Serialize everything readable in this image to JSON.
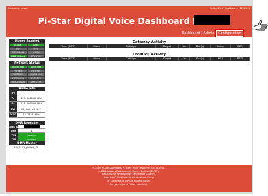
{
  "top_strip": {
    "left": "Hostname: pi-star",
    "right": "Pi-Star:4.1.4 / Dashboard: 20220311"
  },
  "header": {
    "title": "Pi-Star Digital Voice Dashboard for"
  },
  "nav": {
    "dashboard": "Dashboard",
    "separator": "|",
    "admin": "Admin",
    "configuration": "Configuration"
  },
  "modes": {
    "title": "Modes Enabled",
    "items": [
      {
        "label": "D-Star",
        "state": "on"
      },
      {
        "label": "DMR",
        "state": "on"
      },
      {
        "label": "YSF",
        "state": "off"
      },
      {
        "label": "P25",
        "state": "off"
      },
      {
        "label": "YSF XMode",
        "state": "off"
      },
      {
        "label": "NXDN",
        "state": "off"
      },
      {
        "label": "DMR XMode",
        "state": "on"
      },
      {
        "label": "POCSAG",
        "state": "off"
      }
    ]
  },
  "network": {
    "title": "Network Status",
    "items": [
      {
        "label": "D-Star Net",
        "state": "on"
      },
      {
        "label": "DMR Net",
        "state": "on"
      },
      {
        "label": "YSF Net",
        "state": "off"
      },
      {
        "label": "P25 Net",
        "state": "off"
      },
      {
        "label": "YSF2DMR",
        "state": "off"
      },
      {
        "label": "NXDN Net",
        "state": "off"
      },
      {
        "label": "YSF2NXDN",
        "state": "off"
      },
      {
        "label": "YSF2P25",
        "state": "off"
      },
      {
        "label": "DMR2NXDN",
        "state": "off"
      },
      {
        "label": "DMR2YSF",
        "state": "off"
      }
    ]
  },
  "radio": {
    "title": "Radio Info",
    "rows": [
      {
        "key": "Trx",
        "value": ""
      },
      {
        "key": "Tx",
        "value": "439.000000 MHz"
      },
      {
        "key": "Rx",
        "value": "434.000000 MHz"
      },
      {
        "key": "FW",
        "value": "HS_Hat:v1.5.2"
      },
      {
        "key": "TCXO",
        "value": "14.7456 MHz"
      }
    ]
  },
  "repeater": {
    "title": "DMR Repeater",
    "dmr_id_key": "DMR ID",
    "dmr_cc_key": "DMR CC",
    "dmr_cc_val": "1",
    "ts1_key": "TS1",
    "ts1_val": "disabled",
    "ts2_key": "TS2",
    "ts2_val": "enabled",
    "master_title": "DMR Master",
    "master_val": "BM_3101_United_St..."
  },
  "gateway": {
    "title": "Gateway Activity",
    "columns": [
      "Time (EDT)",
      "Mode",
      "Callsign",
      "Target",
      "Src",
      "Dur(s)",
      "Loss",
      "BER"
    ]
  },
  "local_rf": {
    "title": "Local RF Activity",
    "columns": [
      "Time (EDT)",
      "Mode",
      "Callsign",
      "Target",
      "Src",
      "Dur(s)",
      "BER",
      "RSSI"
    ]
  },
  "footer": {
    "lines": [
      "Pi-Star / Pi-Star Dashboard, © Andy Taylor (MW0MWZ) 2014-2021.",
      "ircDDBGateway Dashboard by Hans-J. Barthen (DL5DI),",
      "MMDVMDash developed by Kim Huebel (DG9VH),",
      "Need help? Click here for the Facebook Group",
      "or Click here to join the Support Forum",
      "Get your copy of Pi-Star from here."
    ]
  },
  "colors": {
    "header": "#dd4b39",
    "on": "#1fa81f",
    "dark": "#2b2b2b"
  }
}
